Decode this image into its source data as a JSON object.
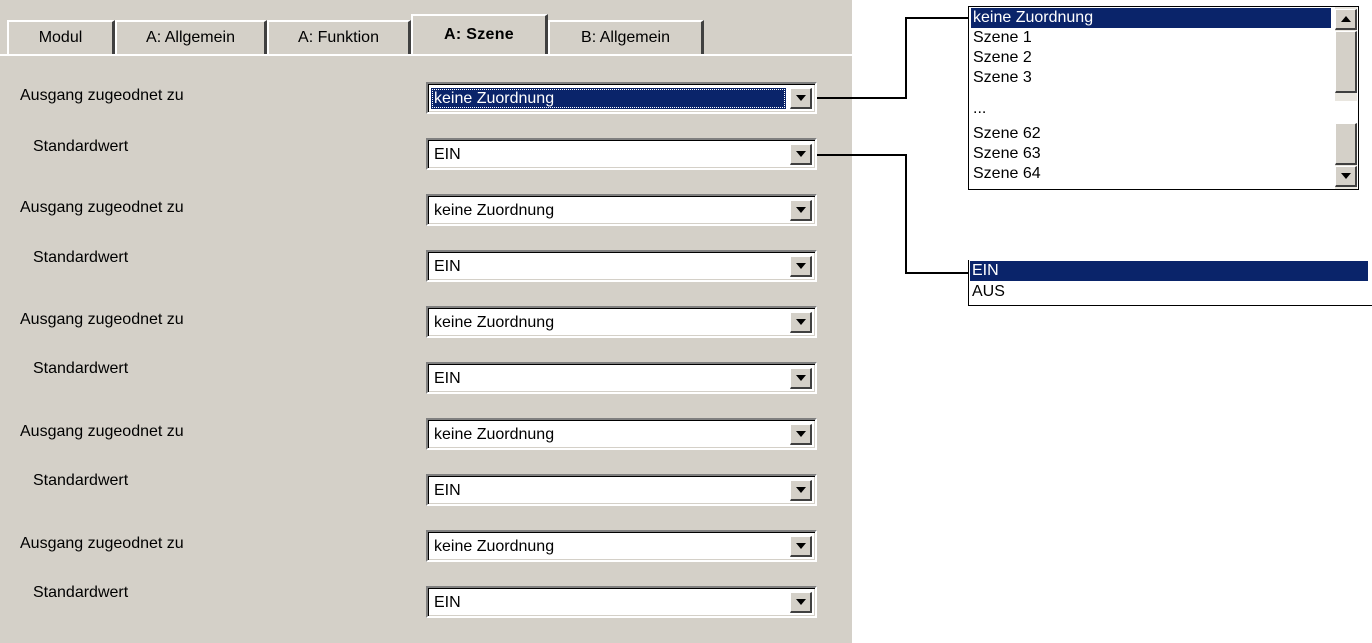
{
  "tabs": [
    {
      "label": "Modul",
      "active": false
    },
    {
      "label": "A: Allgemein",
      "active": false
    },
    {
      "label": "A: Funktion",
      "active": false
    },
    {
      "label": "A: Szene",
      "active": true
    },
    {
      "label": "B: Allgemein",
      "active": false
    }
  ],
  "rows": [
    {
      "label": "Ausgang zugeodnet zu",
      "value": "keine Zuordnung"
    },
    {
      "label": "Standardwert",
      "value": "EIN"
    },
    {
      "label": "Ausgang zugeodnet zu",
      "value": "keine Zuordnung"
    },
    {
      "label": "Standardwert",
      "value": "EIN"
    },
    {
      "label": "Ausgang zugeodnet zu",
      "value": "keine Zuordnung"
    },
    {
      "label": "Standardwert",
      "value": "EIN"
    },
    {
      "label": "Ausgang zugeodnet zu",
      "value": "keine Zuordnung"
    },
    {
      "label": "Standardwert",
      "value": "EIN"
    },
    {
      "label": "Ausgang zugeodnet zu",
      "value": "keine Zuordnung"
    },
    {
      "label": "Standardwert",
      "value": "EIN"
    }
  ],
  "scene_list": {
    "items_top": [
      "keine Zuordnung",
      "Szene 1",
      "Szene 2",
      "Szene 3"
    ],
    "ellipsis": "...",
    "items_bottom": [
      "Szene 62",
      "Szene 63",
      "Szene 64"
    ],
    "selected": "keine Zuordnung"
  },
  "default_list": {
    "items": [
      "EIN",
      "AUS"
    ],
    "selected": "EIN"
  },
  "colors": {
    "dialog_bg": "#d4d0c8",
    "selection_bg": "#0a246a",
    "selection_fg": "#ffffff"
  }
}
